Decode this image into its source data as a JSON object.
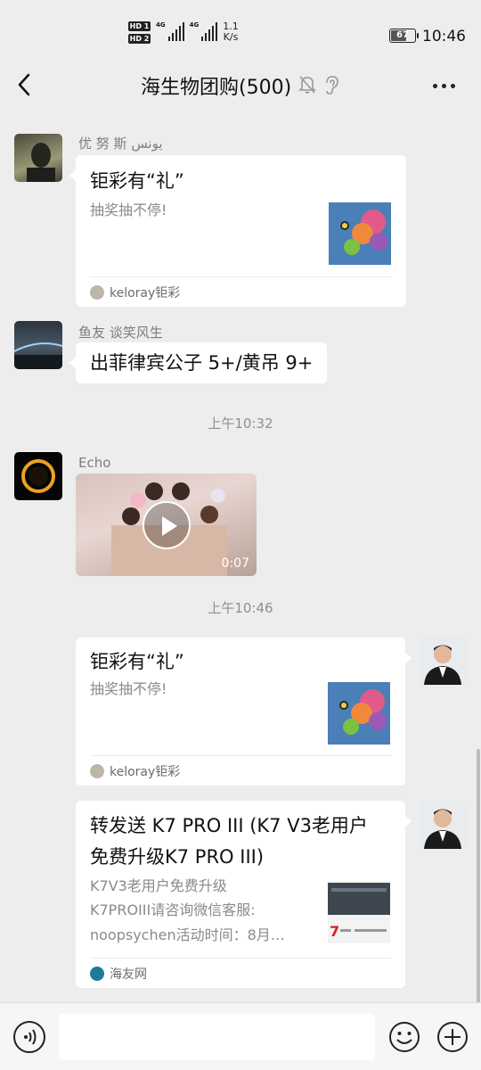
{
  "status_bar": {
    "hd1": "HD 1",
    "hd2": "HD 2",
    "net1": "4G",
    "net2": "4G",
    "speed_value": "1.1",
    "speed_unit": "K/s",
    "battery": "67",
    "battery_level": 0.67,
    "time": "10:46"
  },
  "header": {
    "title": "海生物团购(500)",
    "icons": [
      "back-icon",
      "mute-bell-icon",
      "ear-icon",
      "more-icon"
    ]
  },
  "messages": [
    {
      "sender": "优 努 斯 يونس",
      "type": "link-card",
      "title": "钜彩有“礼”",
      "desc": "抽奖抽不停!",
      "source": "keloray钜彩"
    },
    {
      "sender": "鱼友 谈笑风生",
      "type": "text",
      "text": "出菲律宾公子 5+/黄吊 9+"
    },
    {
      "type": "time",
      "text": "上午10:32"
    },
    {
      "sender": "Echo",
      "type": "video",
      "duration": "0:07"
    },
    {
      "type": "time",
      "text": "上午10:46"
    },
    {
      "type": "link-card",
      "title": "钜彩有“礼”",
      "desc": "抽奖抽不停!",
      "source": "keloray钜彩"
    },
    {
      "type": "link-card",
      "title_line1": "转发送 K7 PRO III (K7 V3老用户",
      "title_line2": "免费升级K7 PRO III)",
      "desc_line1": "K7V3老用户免费升级",
      "desc_line2": "K7PROIII请咨询微信客服:",
      "desc_line3": "noopsychen活动时间：8月…",
      "source": "海友网"
    }
  ],
  "input_bar": {
    "placeholder": "",
    "icons": [
      "voice-icon",
      "emoji-icon",
      "plus-icon"
    ]
  },
  "colors": {
    "background": "#ededed",
    "bubble": "#ffffff",
    "secondary_text": "#8a8a8a"
  }
}
